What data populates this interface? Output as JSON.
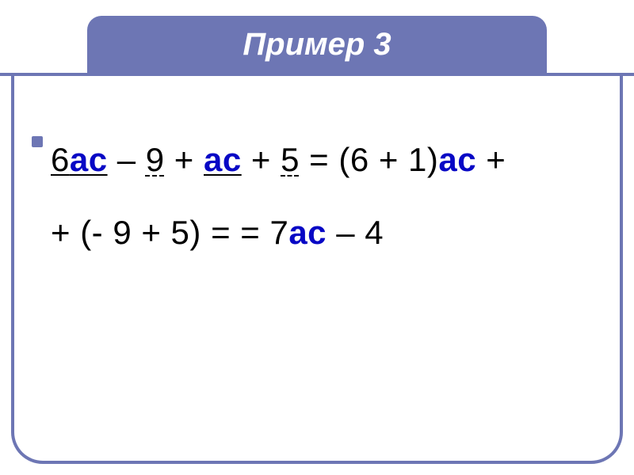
{
  "title": "Пример 3",
  "math": {
    "c1": "6",
    "v1": "ас",
    "op1": " – ",
    "c2": "9",
    "op2": " + ",
    "v2": "ас",
    "op3": " + ",
    "c3": "5",
    "eq1": " = ",
    "g1": "(6 + 1)",
    "v3": "ас",
    "op4": " +",
    "line2_lead": "+ (- 9 + 5) = = 7",
    "v4": "ас",
    "tail": " – 4"
  }
}
